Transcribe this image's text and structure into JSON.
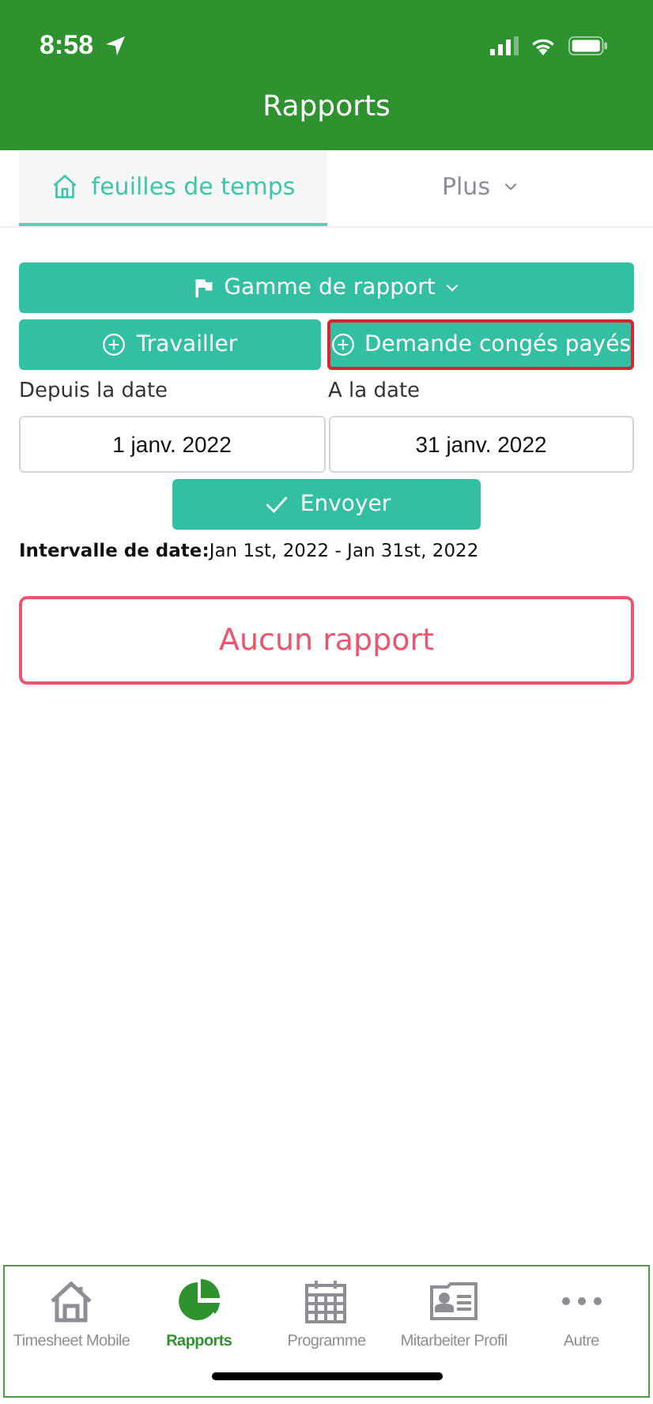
{
  "status_bar": {
    "time": "8:58"
  },
  "header": {
    "title": "Rapports"
  },
  "tabs": [
    {
      "label": "feuilles de temps",
      "selected": true
    },
    {
      "label": "Plus",
      "selected": false
    }
  ],
  "range_button": {
    "label": "Gamme de rapport"
  },
  "actions": [
    {
      "label": "Travailler",
      "highlighted": false
    },
    {
      "label": "Demande congés payés",
      "highlighted": true
    }
  ],
  "dates": [
    {
      "label": "Depuis la date",
      "value": "1 janv. 2022"
    },
    {
      "label": "A la date",
      "value": "31 janv. 2022"
    }
  ],
  "submit": {
    "label": "Envoyer"
  },
  "interval": {
    "text": "**Intervalle de date:**Jan 1st, 2022 - Jan 31st, 2022"
  },
  "empty_message": "Aucun rapport",
  "nav": [
    {
      "label": "Timesheet Mobile",
      "selected": false
    },
    {
      "label": "Rapports",
      "selected": true
    },
    {
      "label": "Programme",
      "selected": false
    },
    {
      "label": "Mitarbeiter Profil",
      "selected": false
    },
    {
      "label": "Autre",
      "selected": false
    }
  ]
}
